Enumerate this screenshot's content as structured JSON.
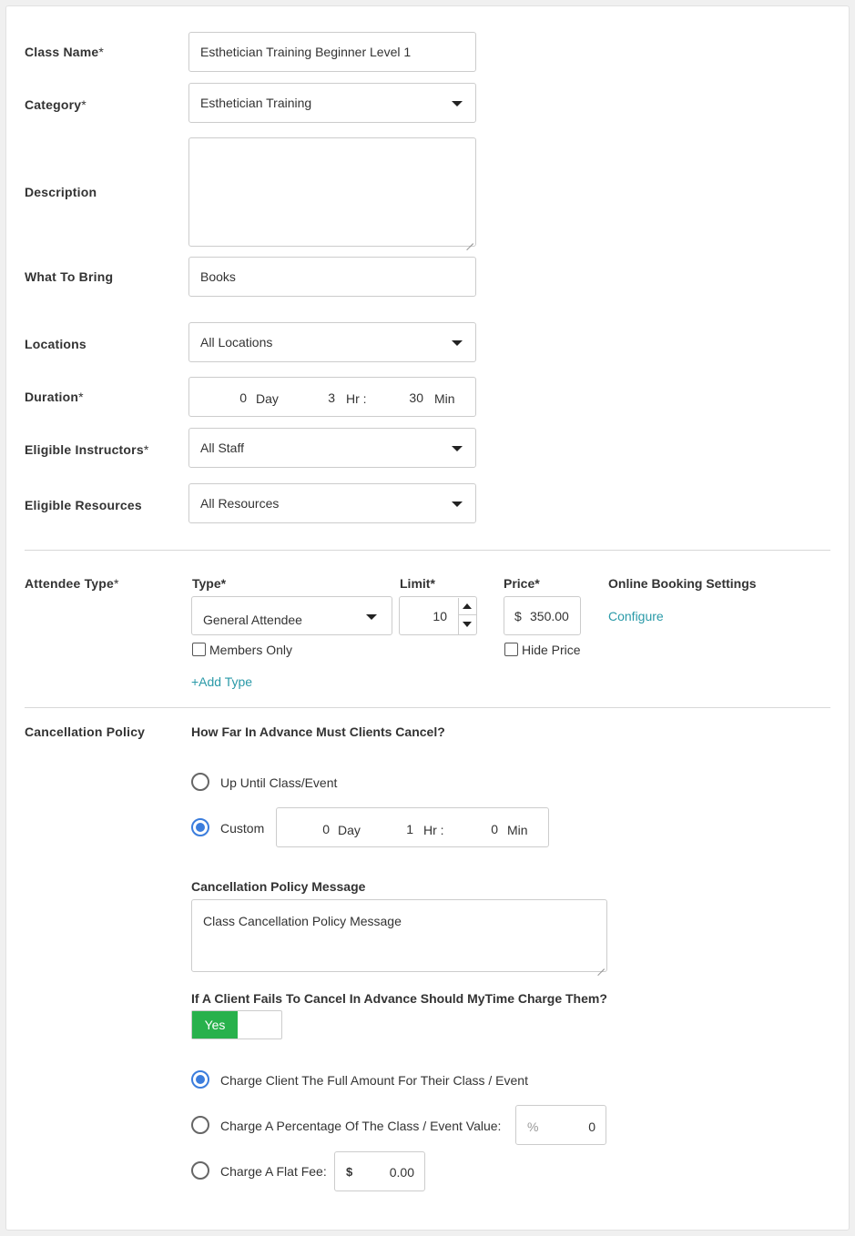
{
  "form": {
    "class_name": {
      "label": "Class Name",
      "req": "*",
      "value": "Esthetician Training Beginner Level 1"
    },
    "category": {
      "label": "Category",
      "req": "*",
      "value": "Esthetician Training"
    },
    "description": {
      "label": "Description",
      "value": ""
    },
    "what_to_bring": {
      "label": "What To Bring",
      "value": "Books"
    },
    "locations": {
      "label": "Locations",
      "value": "All Locations"
    },
    "duration": {
      "label": "Duration",
      "req": "*",
      "day": "0",
      "day_unit": "Day",
      "hr": "3",
      "hr_unit": "Hr :",
      "min": "30",
      "min_unit": "Min"
    },
    "instructors": {
      "label": "Eligible Instructors",
      "req": "*",
      "value": "All Staff"
    },
    "resources": {
      "label": "Eligible Resources",
      "value": "All Resources"
    }
  },
  "attendee": {
    "label": "Attendee Type",
    "req": "*",
    "type_header": "Type*",
    "limit_header": "Limit*",
    "price_header": "Price*",
    "online_header": "Online Booking Settings",
    "type_value": "General Attendee",
    "limit_value": "10",
    "currency": "$",
    "price_value": "350.00",
    "configure_link": "Configure",
    "members_only": "Members Only",
    "hide_price": "Hide Price",
    "add_type": "+Add Type"
  },
  "cancellation": {
    "label": "Cancellation Policy",
    "question": "How Far In Advance Must Clients Cancel?",
    "option_up_until": "Up Until Class/Event",
    "option_custom": "Custom",
    "custom": {
      "day": "0",
      "day_unit": "Day",
      "hr": "1",
      "hr_unit": "Hr :",
      "min": "0",
      "min_unit": "Min"
    },
    "message_label": "Cancellation Policy Message",
    "message_value": "Class Cancellation Policy Message",
    "charge_question": "If A Client Fails To Cancel In Advance Should MyTime Charge Them?",
    "toggle_yes": "Yes",
    "charge_full": "Charge Client The Full Amount For Their Class / Event",
    "charge_percent": "Charge A Percentage Of The Class / Event Value:",
    "percent_symbol": "%",
    "percent_value": "0",
    "charge_flat": "Charge A Flat Fee:",
    "flat_currency": "$",
    "flat_value": "0.00"
  },
  "colors": {
    "accent_blue": "#3b7ddd",
    "link_teal": "#2a9aa8",
    "toggle_green": "#28b14c"
  }
}
